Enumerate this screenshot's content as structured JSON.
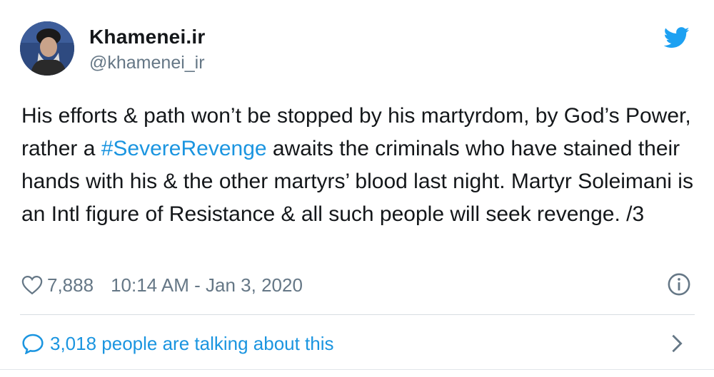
{
  "author": {
    "display_name": "Khamenei.ir",
    "handle": "@khamenei_ir"
  },
  "tweet": {
    "text_before": "His efforts & path won’t be stopped by his martyrdom, by God’s Power, rather a ",
    "hashtag": "#SevereRevenge",
    "text_after": " awaits the criminals who have stained their hands with his & the other martyrs’ blood last night. Martyr Soleimani is an Intl figure of Resistance & all such people will seek revenge. /3"
  },
  "stats": {
    "likes": "7,888",
    "timestamp": "10:14 AM - Jan 3, 2020"
  },
  "conversation": {
    "label": "3,018 people are talking about this"
  },
  "icons": {
    "brand": "twitter-bird-icon",
    "like": "heart-icon",
    "info": "info-icon",
    "reply": "speech-bubble-icon",
    "next": "chevron-right-icon"
  },
  "colors": {
    "link": "#1b95e0",
    "secondary_text": "#657786",
    "primary_text": "#14171a",
    "twitter_blue": "#1da1f2"
  }
}
